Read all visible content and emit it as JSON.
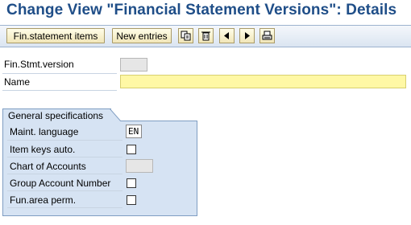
{
  "window": {
    "title": "Change View \"Financial Statement Versions\": Details"
  },
  "toolbar": {
    "fin_items_label": "Fin.statement items",
    "new_entries_label": "New entries",
    "icons": [
      "copy-icon",
      "delete-icon",
      "previous-icon",
      "next-icon",
      "print-icon"
    ]
  },
  "form": {
    "fin_stmt_version": {
      "label": "Fin.Stmt.version",
      "value": ""
    },
    "name": {
      "label": "Name",
      "value": ""
    }
  },
  "general": {
    "title": "General specifications",
    "maint_language": {
      "label": "Maint. language",
      "value": "EN"
    },
    "item_keys_auto": {
      "label": "Item keys auto.",
      "checked": false
    },
    "chart_of_accounts": {
      "label": "Chart of Accounts",
      "value": ""
    },
    "group_account_number": {
      "label": "Group Account Number",
      "checked": false
    },
    "fun_area_perm": {
      "label": "Fun.area perm.",
      "checked": false
    }
  },
  "colors": {
    "title": "#1f4e88",
    "panel": "#d6e3f3",
    "required_field": "#fff8a5"
  }
}
